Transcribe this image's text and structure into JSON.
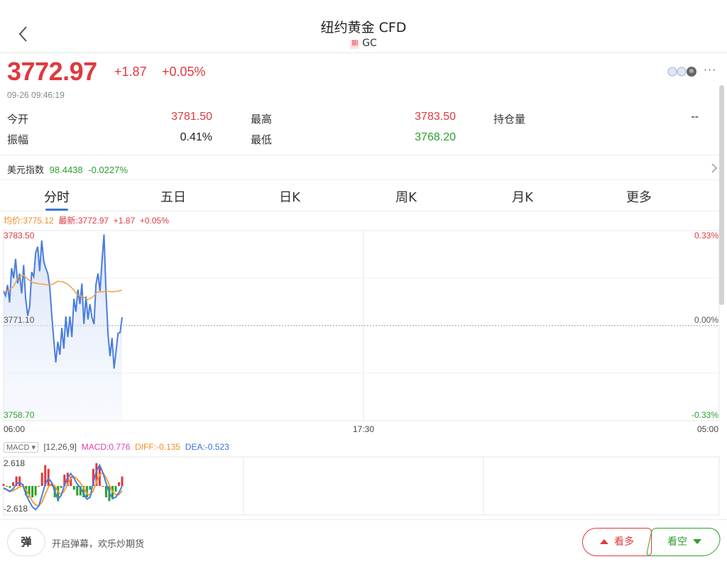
{
  "nav": {
    "title": "纽约黄金 CFD",
    "badge": "期",
    "code": "GC"
  },
  "quote": {
    "price": "3772.97",
    "change": "+1.87",
    "change_pct": "+0.05%",
    "time": "09-26 09:46:19",
    "open_label": "今开",
    "open": "3781.50",
    "high_label": "最高",
    "high": "3783.50",
    "oi_label": "持仓量",
    "oi": "--",
    "amp_label": "振幅",
    "amp": "0.41%",
    "low_label": "最低",
    "low": "3768.20"
  },
  "index": {
    "label": "美元指数",
    "value": "98.4438",
    "change": "-0.0227%"
  },
  "tabs": [
    "分时",
    "五日",
    "日K",
    "周K",
    "月K",
    "更多"
  ],
  "legend": {
    "avg": "均价:3775.12",
    "latest": "最新:3772.97",
    "change": "+1.87",
    "pct": "+0.05%"
  },
  "chart_data": {
    "type": "line",
    "y_axis_left": [
      "3783.50",
      "3771.10",
      "3758.70"
    ],
    "y_axis_right": [
      "0.33%",
      "0.00%",
      "-0.33%"
    ],
    "x_axis": [
      "06:00",
      "17:30",
      "05:00"
    ],
    "ylim": [
      3758.7,
      3783.5
    ],
    "series": [
      {
        "color": "#4a7de0",
        "values": [
          3775.6,
          3775.0,
          3776.4,
          3774.1,
          3778.6,
          3777.3,
          3779.8,
          3776.6,
          3777.9,
          3775.3,
          3779.0,
          3774.7,
          3772.4,
          3773.6,
          3778.1,
          3777.5,
          3780.6,
          3781.4,
          3778.2,
          3782.2,
          3779.5,
          3778.6,
          3777.9,
          3776.1,
          3772.5,
          3769.2,
          3766.3,
          3769.0,
          3767.3,
          3770.8,
          3768.1,
          3772.3,
          3769.6,
          3772.3,
          3769.6,
          3774.6,
          3772.9,
          3775.8,
          3773.9,
          3776.6,
          3771.3,
          3774.9,
          3771.9,
          3773.9,
          3772.2,
          3771.3,
          3776.5,
          3777.9,
          3775.6,
          3779.6,
          3783.0,
          3775.3,
          3769.9,
          3767.1,
          3769.5,
          3765.5,
          3767.8,
          3770.1,
          3770.2,
          3772.2
        ]
      },
      {
        "color": "#f0a040",
        "values": [
          3775.5,
          3775.7,
          3776.2,
          3777.4,
          3777.7,
          3777.1,
          3776.7,
          3776.6,
          3776.5,
          3776.4,
          3776.5,
          3776.9,
          3776.8,
          3776.5,
          3775.9,
          3775.1,
          3774.9,
          3774.5,
          3774.8,
          3775.5,
          3775.5,
          3775.6,
          3775.5,
          3775.6,
          3775.7
        ]
      }
    ]
  },
  "macd": {
    "selector": "MACD",
    "params": "[12,26,9]",
    "macd": "MACD:0.776",
    "diff": "DIFF:-0.135",
    "dea": "DEA:-0.523",
    "top": "2.618",
    "bottom": "-2.618"
  },
  "macd_data": {
    "ylim": [
      -2.618,
      2.618
    ],
    "diff": [
      -0.2,
      -0.4,
      -0.6,
      -0.3,
      0.2,
      0.4,
      0.1,
      -0.9,
      -1.6,
      -2.2,
      -2.5,
      -2.1,
      -1.0,
      0.2,
      0.8,
      0.4,
      -0.6,
      -1.4,
      -1.0,
      0.1,
      0.9,
      1.3,
      0.8,
      0.2,
      -0.2,
      -0.8,
      -1.4,
      -1.2,
      0.4,
      1.6,
      2.2,
      1.4,
      0.3,
      -0.7,
      -1.3,
      -1.2,
      -0.7,
      0.0
    ],
    "dea": [
      -0.3,
      -0.4,
      -0.5,
      -0.5,
      -0.3,
      -0.1,
      0.0,
      -0.4,
      -1.0,
      -1.6,
      -2.0,
      -2.1,
      -1.7,
      -0.9,
      -0.1,
      0.3,
      0.0,
      -0.6,
      -0.9,
      -0.5,
      0.2,
      0.8,
      1.0,
      0.7,
      0.3,
      -0.2,
      -0.8,
      -1.0,
      -0.5,
      0.4,
      1.2,
      1.4,
      0.9,
      0.1,
      -0.6,
      -0.9,
      -0.9,
      -0.5
    ]
  },
  "bottom": {
    "danmaku_label": "弹",
    "tip": "开启弹幕，欢乐炒期货",
    "bull": "看多",
    "bear": "看空"
  },
  "colors": {
    "up": "#e0393e",
    "down": "#2ca02c",
    "accent": "#3a7bd5",
    "avg_line": "#f08c2a"
  }
}
